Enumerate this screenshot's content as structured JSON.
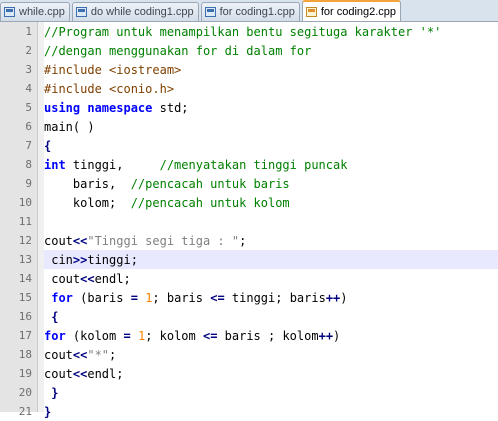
{
  "tabs": [
    {
      "label": "while.cpp",
      "active": false
    },
    {
      "label": "do while coding1.cpp",
      "active": false
    },
    {
      "label": "for coding1.cpp",
      "active": false
    },
    {
      "label": "for coding2.cpp",
      "active": true
    }
  ],
  "editor": {
    "current_line": 13,
    "colors": {
      "comment": "#008000",
      "preprocessor": "#804000",
      "keyword": "#0000ff",
      "string": "#808080",
      "number": "#ff8000",
      "operator": "#000080",
      "current_line_highlight": "#e8e8ff",
      "active_tab_accent": "#f3a33c"
    },
    "lines": [
      {
        "number": "1",
        "tokens": [
          {
            "t": "//Program untuk menampilkan bentu segituga karakter '*'",
            "c": "comment"
          }
        ]
      },
      {
        "number": "2",
        "tokens": [
          {
            "t": "//dengan menggunakan for di dalam for",
            "c": "comment"
          }
        ]
      },
      {
        "number": "3",
        "tokens": [
          {
            "t": "#include <iostream>",
            "c": "pre"
          }
        ]
      },
      {
        "number": "4",
        "tokens": [
          {
            "t": "#include <conio.h>",
            "c": "pre"
          }
        ]
      },
      {
        "number": "5",
        "tokens": [
          {
            "t": "using",
            "c": "kw"
          },
          {
            "t": " ",
            "c": "plain"
          },
          {
            "t": "namespace",
            "c": "kw"
          },
          {
            "t": " std;",
            "c": "plain"
          }
        ]
      },
      {
        "number": "6",
        "tokens": [
          {
            "t": "main( )",
            "c": "plain"
          }
        ]
      },
      {
        "number": "7",
        "tokens": [
          {
            "t": "{",
            "c": "op"
          }
        ]
      },
      {
        "number": "8",
        "tokens": [
          {
            "t": "int",
            "c": "kw"
          },
          {
            "t": " tinggi,     ",
            "c": "plain"
          },
          {
            "t": "//menyatakan tinggi puncak",
            "c": "comment"
          }
        ]
      },
      {
        "number": "9",
        "tokens": [
          {
            "t": "    baris,  ",
            "c": "plain"
          },
          {
            "t": "//pencacah untuk baris",
            "c": "comment"
          }
        ]
      },
      {
        "number": "10",
        "tokens": [
          {
            "t": "    kolom;  ",
            "c": "plain"
          },
          {
            "t": "//pencacah untuk kolom",
            "c": "comment"
          }
        ]
      },
      {
        "number": "11",
        "tokens": []
      },
      {
        "number": "12",
        "tokens": [
          {
            "t": "cout",
            "c": "plain"
          },
          {
            "t": "<<",
            "c": "op"
          },
          {
            "t": "\"Tinggi segi tiga : \"",
            "c": "str"
          },
          {
            "t": ";",
            "c": "plain"
          }
        ]
      },
      {
        "number": "13",
        "tokens": [
          {
            "t": " cin",
            "c": "plain"
          },
          {
            "t": ">>",
            "c": "op"
          },
          {
            "t": "tinggi;",
            "c": "plain"
          }
        ]
      },
      {
        "number": "14",
        "tokens": [
          {
            "t": " cout",
            "c": "plain"
          },
          {
            "t": "<<",
            "c": "op"
          },
          {
            "t": "endl;",
            "c": "plain"
          }
        ]
      },
      {
        "number": "15",
        "tokens": [
          {
            "t": " ",
            "c": "plain"
          },
          {
            "t": "for",
            "c": "kw"
          },
          {
            "t": " (baris ",
            "c": "plain"
          },
          {
            "t": "=",
            "c": "op"
          },
          {
            "t": " ",
            "c": "plain"
          },
          {
            "t": "1",
            "c": "num"
          },
          {
            "t": "; baris ",
            "c": "plain"
          },
          {
            "t": "<=",
            "c": "op"
          },
          {
            "t": " tinggi; baris",
            "c": "plain"
          },
          {
            "t": "++",
            "c": "op"
          },
          {
            "t": ")",
            "c": "plain"
          }
        ]
      },
      {
        "number": "16",
        "tokens": [
          {
            "t": " {",
            "c": "op"
          }
        ]
      },
      {
        "number": "17",
        "tokens": [
          {
            "t": "for",
            "c": "kw"
          },
          {
            "t": " (kolom ",
            "c": "plain"
          },
          {
            "t": "=",
            "c": "op"
          },
          {
            "t": " ",
            "c": "plain"
          },
          {
            "t": "1",
            "c": "num"
          },
          {
            "t": "; kolom ",
            "c": "plain"
          },
          {
            "t": "<=",
            "c": "op"
          },
          {
            "t": " baris ; kolom",
            "c": "plain"
          },
          {
            "t": "++",
            "c": "op"
          },
          {
            "t": ")",
            "c": "plain"
          }
        ]
      },
      {
        "number": "18",
        "tokens": [
          {
            "t": "cout",
            "c": "plain"
          },
          {
            "t": "<<",
            "c": "op"
          },
          {
            "t": "\"*\"",
            "c": "str"
          },
          {
            "t": ";",
            "c": "plain"
          }
        ]
      },
      {
        "number": "19",
        "tokens": [
          {
            "t": "cout",
            "c": "plain"
          },
          {
            "t": "<<",
            "c": "op"
          },
          {
            "t": "endl;",
            "c": "plain"
          }
        ]
      },
      {
        "number": "20",
        "tokens": [
          {
            "t": " }",
            "c": "op"
          }
        ]
      },
      {
        "number": "21",
        "tokens": [
          {
            "t": "}",
            "c": "op"
          }
        ]
      }
    ]
  }
}
